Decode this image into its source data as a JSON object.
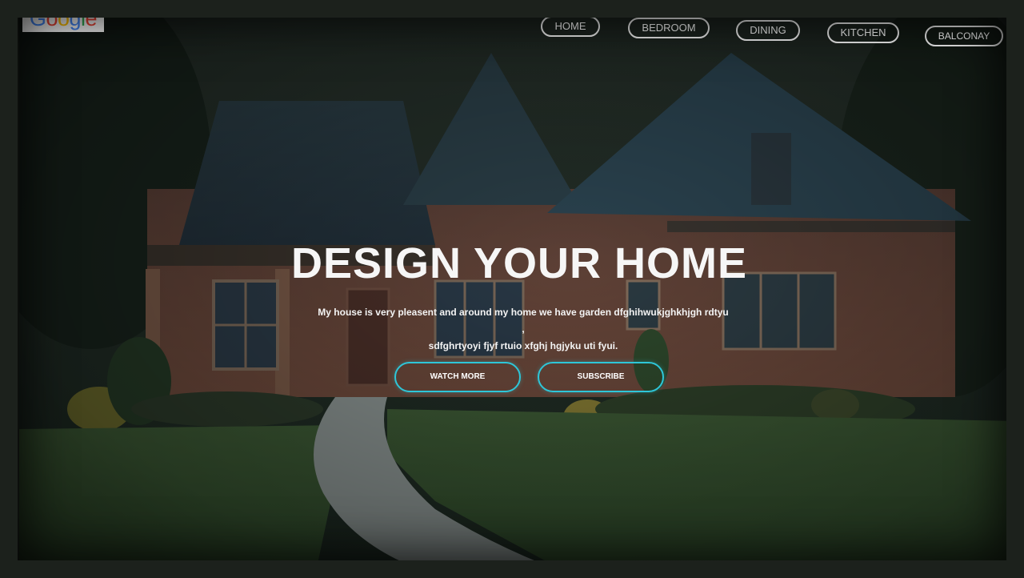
{
  "brand": {
    "logo_letters": [
      "G",
      "o",
      "o",
      "g",
      "l",
      "e"
    ],
    "logo_colors": [
      "#4285F4",
      "#EA4335",
      "#FBBC05",
      "#4285F4",
      "#34A853",
      "#EA4335"
    ]
  },
  "nav": {
    "items": [
      {
        "label": "HOME"
      },
      {
        "label": "BEDROOM"
      },
      {
        "label": "DINING"
      },
      {
        "label": "KITCHEN"
      },
      {
        "label": "BALCONAY"
      }
    ]
  },
  "hero": {
    "title": "DESIGN YOUR HOME",
    "description_line1": "My house is very pleasent and around my home we have garden dfghihwukjghkhjgh rdtyu ,",
    "description_line2": "sdfghrtyoyi fjyf rtuio xfghj hgjyku uti fyui.",
    "buttons": {
      "watch_more": "WATCH MORE",
      "subscribe": "SUBSCRIBE"
    },
    "accent_color": "#2ec6d8"
  }
}
